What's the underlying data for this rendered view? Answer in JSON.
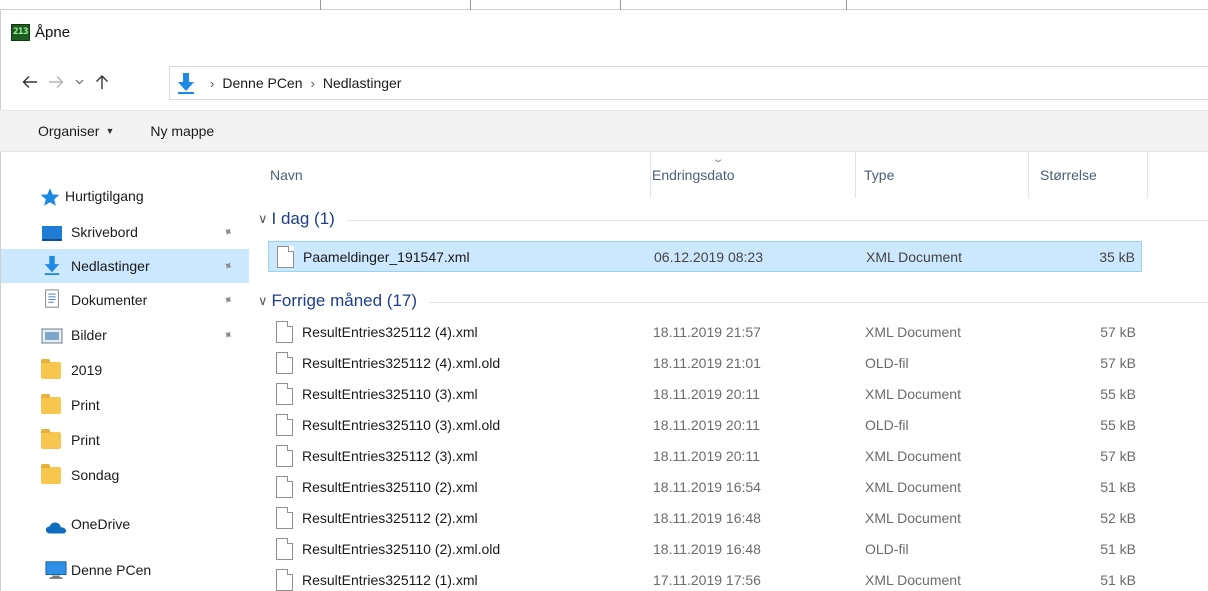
{
  "window": {
    "app_icon_text": "213",
    "title": "Åpne"
  },
  "navigation": {
    "back_icon": "arrow-left-icon",
    "forward_icon": "arrow-right-icon",
    "recent_icon": "chevron-down-icon",
    "up_icon": "arrow-up-icon",
    "breadcrumbs": [
      "Denne PCen",
      "Nedlastinger"
    ],
    "separator": "›"
  },
  "toolbar": {
    "organize_label": "Organiser",
    "new_folder_label": "Ny mappe"
  },
  "sidebar": {
    "items": [
      {
        "label": "Hurtigtilgang",
        "icon": "star-icon"
      },
      {
        "label": "Skrivebord",
        "icon": "desktop-icon",
        "pinned": true
      },
      {
        "label": "Nedlastinger",
        "icon": "download-icon",
        "pinned": true,
        "selected": true
      },
      {
        "label": "Dokumenter",
        "icon": "document-icon",
        "pinned": true
      },
      {
        "label": "Bilder",
        "icon": "pictures-icon",
        "pinned": true
      },
      {
        "label": "2019",
        "icon": "folder-icon"
      },
      {
        "label": "Print",
        "icon": "folder-icon"
      },
      {
        "label": "Print",
        "icon": "folder-icon"
      },
      {
        "label": "Sondag",
        "icon": "folder-icon"
      },
      {
        "label": "OneDrive",
        "icon": "cloud-icon"
      },
      {
        "label": "Denne PCen",
        "icon": "computer-icon"
      }
    ]
  },
  "columns": {
    "name": "Navn",
    "date": "Endringsdato",
    "type": "Type",
    "size": "Størrelse"
  },
  "groups": [
    {
      "label": "I dag (1)",
      "files": [
        {
          "name": "Paameldinger_191547.xml",
          "date": "06.12.2019 08:23",
          "type": "XML Document",
          "size": "35 kB",
          "selected": true
        }
      ]
    },
    {
      "label": "Forrige måned (17)",
      "files": [
        {
          "name": "ResultEntries325112 (4).xml",
          "date": "18.11.2019 21:57",
          "type": "XML Document",
          "size": "57 kB"
        },
        {
          "name": "ResultEntries325112 (4).xml.old",
          "date": "18.11.2019 21:01",
          "type": "OLD-fil",
          "size": "57 kB"
        },
        {
          "name": "ResultEntries325110 (3).xml",
          "date": "18.11.2019 20:11",
          "type": "XML Document",
          "size": "55 kB"
        },
        {
          "name": "ResultEntries325110 (3).xml.old",
          "date": "18.11.2019 20:11",
          "type": "OLD-fil",
          "size": "55 kB"
        },
        {
          "name": "ResultEntries325112 (3).xml",
          "date": "18.11.2019 20:11",
          "type": "XML Document",
          "size": "57 kB"
        },
        {
          "name": "ResultEntries325110 (2).xml",
          "date": "18.11.2019 16:54",
          "type": "XML Document",
          "size": "51 kB"
        },
        {
          "name": "ResultEntries325112 (2).xml",
          "date": "18.11.2019 16:48",
          "type": "XML Document",
          "size": "52 kB"
        },
        {
          "name": "ResultEntries325110 (2).xml.old",
          "date": "18.11.2019 16:48",
          "type": "OLD-fil",
          "size": "51 kB"
        },
        {
          "name": "ResultEntries325112 (1).xml",
          "date": "17.11.2019 17:56",
          "type": "XML Document",
          "size": "51 kB"
        }
      ]
    }
  ],
  "colors": {
    "selection": "#cce8ff",
    "selection_border": "#99d1ff",
    "group_header": "#1e3d8f",
    "column_header": "#4c607a",
    "accent_blue": "#1e88e5"
  }
}
